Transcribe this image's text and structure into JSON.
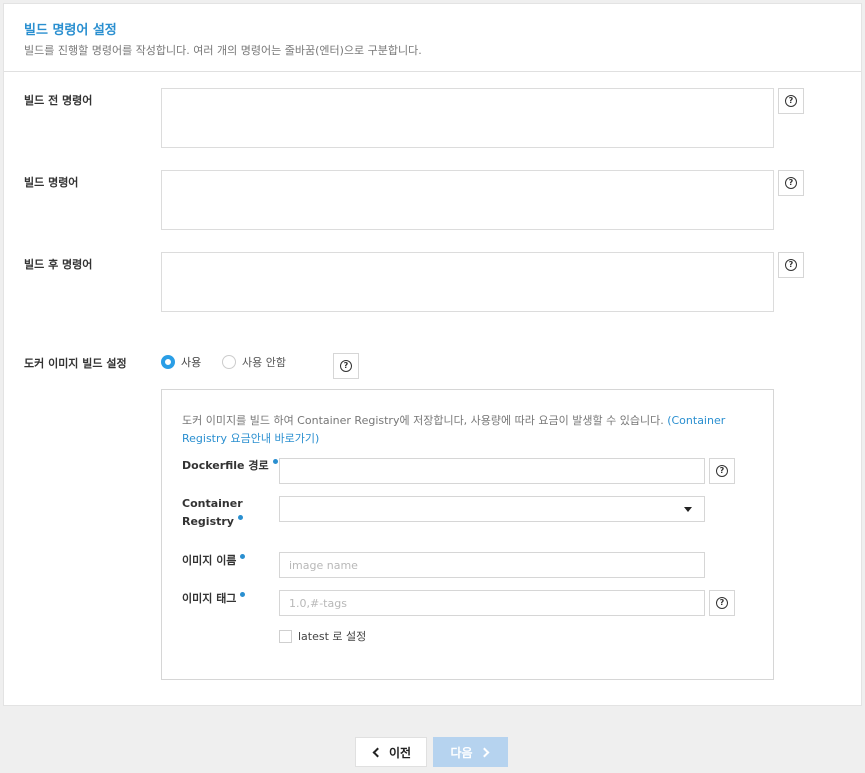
{
  "header": {
    "title": "빌드 명령어 설정",
    "subtitle": "빌드를 진행할 명령어를 작성합니다. 여러 개의 명령어는 줄바꿈(엔터)으로 구분합니다."
  },
  "fields": {
    "pre_build_label": "빌드 전 명령어",
    "pre_build_value": "",
    "build_label": "빌드 명령어",
    "build_value": "",
    "post_build_label": "빌드 후 명령어",
    "post_build_value": ""
  },
  "docker": {
    "label": "도커 이미지 빌드 설정",
    "option_use": "사용",
    "option_not_use": "사용 안함",
    "selected": "사용",
    "notice_text": "도커 이미지를 빌드 하여 Container Registry에 저장합니다, 사용량에 따라 요금이 발생할 수 있습니다. ",
    "notice_link": "(Container Registry 요금안내 바로가기)",
    "dockerfile_label": "Dockerfile 경로",
    "dockerfile_value": "",
    "registry_label_line1": "Container",
    "registry_label_line2": "Registry",
    "registry_selected": "",
    "image_name_label": "이미지 이름",
    "image_name_placeholder": "image name",
    "image_tag_label": "이미지 태그",
    "image_tag_placeholder": "1.0,#-tags",
    "latest_label": "latest 로 설정",
    "latest_checked": false
  },
  "icons": {
    "help": "help-circle-icon",
    "chevron_left": "chevron-left-icon",
    "chevron_right": "chevron-right-icon",
    "dropdown": "caret-down-icon"
  },
  "buttons": {
    "prev_label": "이전",
    "next_label": "다음"
  },
  "colors": {
    "accent": "#2a8fd0",
    "radio_active": "#2a9ee6",
    "next_disabled": "#b6d3ef",
    "page_bg": "#efefef"
  }
}
